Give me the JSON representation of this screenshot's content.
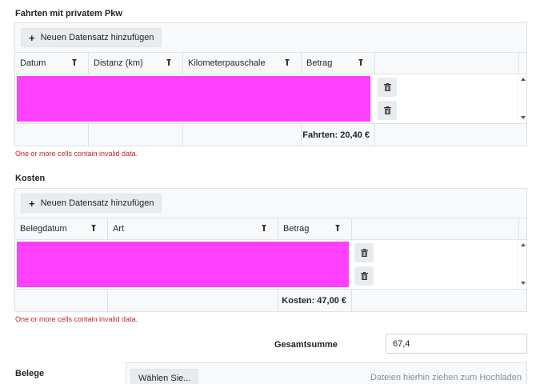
{
  "fahrten": {
    "title": "Fahrten mit privatem Pkw",
    "add_label": "Neuen Datensatz hinzufügen",
    "columns": [
      "Datum",
      "Distanz (km)",
      "Kilometerpauschale",
      "Betrag"
    ],
    "total": "Fahrten: 20,40 €",
    "error": "One or more cells contain invalid data."
  },
  "kosten": {
    "title": "Kosten",
    "add_label": "Neuen Datensatz hinzufügen",
    "columns": [
      "Belegdatum",
      "Art",
      "Betrag"
    ],
    "total": "Kosten: 47,00 €",
    "error": "One or more cells contain invalid data."
  },
  "summary": {
    "label": "Gesamtsumme",
    "value": "67,4"
  },
  "belege": {
    "label": "Belege",
    "choose_label": "Wählen Sie...",
    "drop_hint": "Dateien hierhin ziehen zum Hochladen"
  },
  "colors": {
    "row_highlight": "#ff40ff",
    "error": "#c62828"
  }
}
